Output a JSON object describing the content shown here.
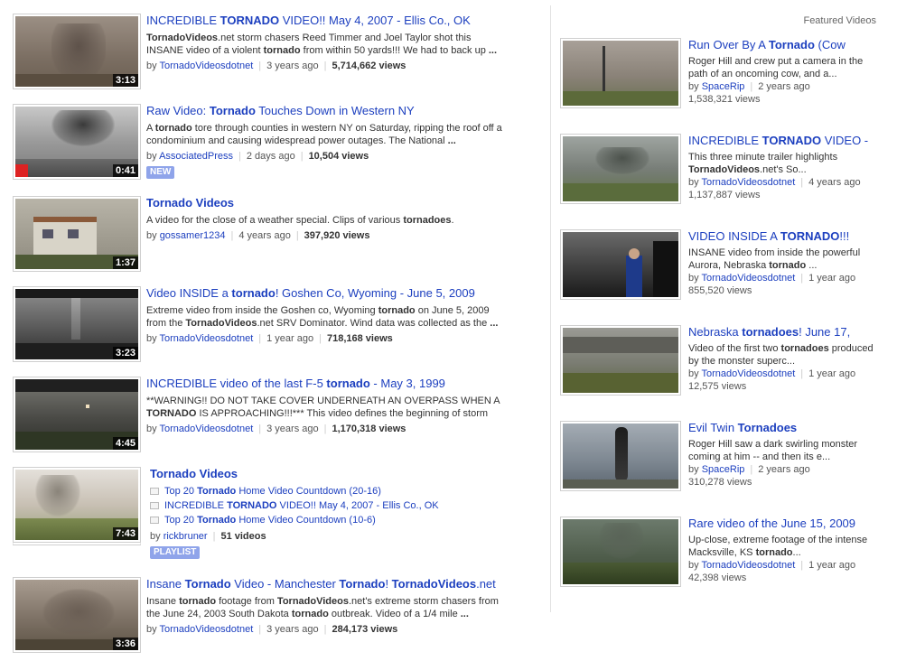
{
  "results": [
    {
      "title_parts": [
        "INCREDIBLE ",
        "TORNADO",
        " VIDEO!! May 4, 2007 - Ellis Co., OK"
      ],
      "title_bold": [
        false,
        true,
        false
      ],
      "desc_parts": [
        "TornadoVideos",
        ".net storm chasers Reed Timmer and Joel Taylor shot this INSANE video of a violent ",
        "tornado",
        " from within 50 yards!!! We had to back up ",
        "..."
      ],
      "desc_bold": [
        true,
        false,
        true,
        false,
        true
      ],
      "by": "by",
      "author": "TornadoVideosdotnet",
      "age": "3 years ago",
      "views": "5,714,662 views",
      "duration": "3:13",
      "badge": ""
    },
    {
      "title_parts": [
        "Raw Video: ",
        "Tornado",
        " Touches Down in Western NY"
      ],
      "title_bold": [
        false,
        true,
        false
      ],
      "desc_parts": [
        "A ",
        "tornado",
        " tore through counties in western NY on Saturday, ripping the roof off a condominium and causing widespread power outages. The National ",
        "..."
      ],
      "desc_bold": [
        false,
        true,
        false,
        true
      ],
      "by": "by",
      "author": "AssociatedPress",
      "age": "2 days ago",
      "views": "10,504 views",
      "duration": "0:41",
      "badge": "NEW"
    },
    {
      "title_parts": [
        "Tornado Videos"
      ],
      "title_bold": [
        true
      ],
      "desc_parts": [
        "A video for the close of a weather special. Clips of various ",
        "tornadoes",
        "."
      ],
      "desc_bold": [
        false,
        true,
        false
      ],
      "by": "by",
      "author": "gossamer1234",
      "age": "4 years ago",
      "views": "397,920 views",
      "duration": "1:37",
      "badge": ""
    },
    {
      "title_parts": [
        "Video INSIDE a ",
        "tornado",
        "! Goshen Co, Wyoming - June 5, 2009"
      ],
      "title_bold": [
        false,
        true,
        false
      ],
      "desc_parts": [
        "Extreme video from inside the Goshen co, Wyoming ",
        "tornado",
        " on June 5, 2009 from the ",
        "TornadoVideos",
        ".net SRV Dominator. Wind data was collected as the ",
        "..."
      ],
      "desc_bold": [
        false,
        true,
        false,
        true,
        false,
        true
      ],
      "by": "by",
      "author": "TornadoVideosdotnet",
      "age": "1 year ago",
      "views": "718,168 views",
      "duration": "3:23",
      "badge": ""
    },
    {
      "title_parts": [
        "INCREDIBLE video of the last F-5 ",
        "tornado",
        " - May 3, 1999"
      ],
      "title_bold": [
        false,
        true,
        false
      ],
      "desc_parts": [
        "**WARNING!! DO NOT TAKE COVER UNDERNEATH AN OVERPASS WHEN A ",
        "TORNADO",
        " IS APPROACHING!!!*** This video defines the beginning of storm"
      ],
      "desc_bold": [
        false,
        true,
        false
      ],
      "by": "by",
      "author": "TornadoVideosdotnet",
      "age": "3 years ago",
      "views": "1,170,318 views",
      "duration": "4:45",
      "badge": ""
    }
  ],
  "playlist": {
    "title": "Tornado Videos",
    "items": [
      {
        "parts": [
          "Top 20 ",
          "Tornado",
          " Home Video Countdown (20-16)"
        ],
        "bold": [
          false,
          true,
          false
        ]
      },
      {
        "parts": [
          "INCREDIBLE ",
          "TORNADO",
          " VIDEO!! May 4, 2007 - Ellis Co., OK"
        ],
        "bold": [
          false,
          true,
          false
        ]
      },
      {
        "parts": [
          "Top 20 ",
          "Tornado",
          " Home Video Countdown (10-6)"
        ],
        "bold": [
          false,
          true,
          false
        ]
      }
    ],
    "by": "by",
    "author": "rickbruner",
    "count": "51 videos",
    "duration": "7:43",
    "badge": "PLAYLIST"
  },
  "last_result": {
    "title_parts": [
      "Insane ",
      "Tornado",
      " Video - Manchester ",
      "Tornado",
      "! ",
      "TornadoVideos",
      ".net"
    ],
    "title_bold": [
      false,
      true,
      false,
      true,
      false,
      true,
      false
    ],
    "desc_parts": [
      "Insane ",
      "tornado",
      " footage from ",
      "TornadoVideos",
      ".net's extreme storm chasers from the June 24, 2003 South Dakota ",
      "tornado",
      " outbreak. Video of a 1/4 mile ",
      "..."
    ],
    "desc_bold": [
      false,
      true,
      false,
      true,
      false,
      true,
      false,
      true
    ],
    "by": "by",
    "author": "TornadoVideosdotnet",
    "age": "3 years ago",
    "views": "284,173 views",
    "duration": "3:36"
  },
  "featured": {
    "heading": "Featured Videos",
    "items": [
      {
        "title_parts": [
          "Run Over By A ",
          "Tornado",
          " (Cow"
        ],
        "title_bold": [
          false,
          true,
          false
        ],
        "desc_parts": [
          "Roger Hill and crew put a camera in the path of an oncoming cow, and a..."
        ],
        "desc_bold": [
          false
        ],
        "by": "by",
        "author": "SpaceRip",
        "age": "2 years ago",
        "views": "1,538,321 views"
      },
      {
        "title_parts": [
          "INCREDIBLE ",
          "TORNADO",
          " VIDEO -"
        ],
        "title_bold": [
          false,
          true,
          false
        ],
        "desc_parts": [
          "This three minute trailer highlights ",
          "TornadoVideos",
          ".net's So..."
        ],
        "desc_bold": [
          false,
          true,
          false
        ],
        "by": "by",
        "author": "TornadoVideosdotnet",
        "age": "4 years ago",
        "views": "1,137,887 views"
      },
      {
        "title_parts": [
          "VIDEO INSIDE A ",
          "TORNADO",
          "!!!"
        ],
        "title_bold": [
          false,
          true,
          false
        ],
        "desc_parts": [
          "INSANE video from inside the powerful Aurora, Nebraska ",
          "tornado",
          " ..."
        ],
        "desc_bold": [
          false,
          true,
          false
        ],
        "by": "by",
        "author": "TornadoVideosdotnet",
        "age": "1 year ago",
        "views": "855,520 views"
      },
      {
        "title_parts": [
          "Nebraska ",
          "tornadoes",
          "! June 17,"
        ],
        "title_bold": [
          false,
          true,
          false
        ],
        "desc_parts": [
          "Video of the first two ",
          "tornadoes",
          " produced by the monster superc..."
        ],
        "desc_bold": [
          false,
          true,
          false
        ],
        "by": "by",
        "author": "TornadoVideosdotnet",
        "age": "1 year ago",
        "views": "12,575 views"
      },
      {
        "title_parts": [
          "Evil Twin ",
          "Tornadoes"
        ],
        "title_bold": [
          false,
          true
        ],
        "desc_parts": [
          "Roger Hill saw a dark swirling monster coming at him -- and then its e..."
        ],
        "desc_bold": [
          false
        ],
        "by": "by",
        "author": "SpaceRip",
        "age": "2 years ago",
        "views": "310,278 views"
      },
      {
        "title_parts": [
          "Rare video of the June 15, 2009"
        ],
        "title_bold": [
          false
        ],
        "desc_parts": [
          "Up-close, extreme footage of the intense Macksville, KS ",
          "tornado",
          "..."
        ],
        "desc_bold": [
          false,
          true,
          false
        ],
        "by": "by",
        "author": "TornadoVideosdotnet",
        "age": "1 year ago",
        "views": "42,398 views"
      }
    ]
  },
  "colors": {
    "link": "#1c3fbf",
    "badge": "#8fa4ea",
    "text": "#333333",
    "meta": "#555555"
  }
}
